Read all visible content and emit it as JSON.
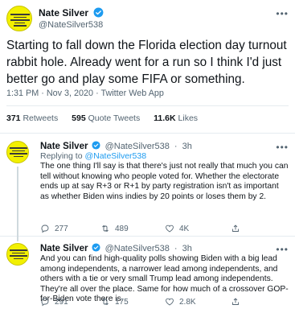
{
  "main_tweet": {
    "author_name": "Nate Silver",
    "verified_icon": "verified-badge-icon",
    "author_handle": "@NateSilver538",
    "text": "Starting to fall down the Florida election day turnout rabbit hole. Already went for a run so I think I'd just better go and play some FIFA or something.",
    "time": "1:31 PM",
    "date": "Nov 3, 2020",
    "source": "Twitter Web App",
    "meta_separator": "·",
    "stats": [
      {
        "count": "371",
        "label": "Retweets"
      },
      {
        "count": "595",
        "label": "Quote Tweets"
      },
      {
        "count": "11.6K",
        "label": "Likes"
      }
    ]
  },
  "replies": [
    {
      "author_name": "Nate Silver",
      "verified_icon": "verified-badge-icon",
      "author_handle": "@NateSilver538",
      "separator": "·",
      "time": "3h",
      "replying_prefix": "Replying to",
      "replying_to": "@NateSilver538",
      "text": "The one thing I'll say is that there's just not really that much you can tell without knowing who people voted for. Whether the electorate ends up at say R+3 or R+1 by party registration isn't as important as whether Biden wins indies by 20 points or loses them by 2.",
      "reply_count": "277",
      "retweet_count": "489",
      "like_count": "4K"
    },
    {
      "author_name": "Nate Silver",
      "verified_icon": "verified-badge-icon",
      "author_handle": "@NateSilver538",
      "separator": "·",
      "time": "3h",
      "text": "And you can find high-quality polls showing Biden with a big lead among independents, a narrower lead among independents, and others with a tie or very small Trump lead among independents. They're all over the place. Same for how much of a crossover GOP-for-Biden vote there is.",
      "reply_count": "291",
      "retweet_count": "175",
      "like_count": "2.8K"
    }
  ],
  "colors": {
    "accent": "#1d9bf0",
    "text": "#0f1419",
    "muted": "#536471",
    "avatar_bg": "#f2f000"
  }
}
